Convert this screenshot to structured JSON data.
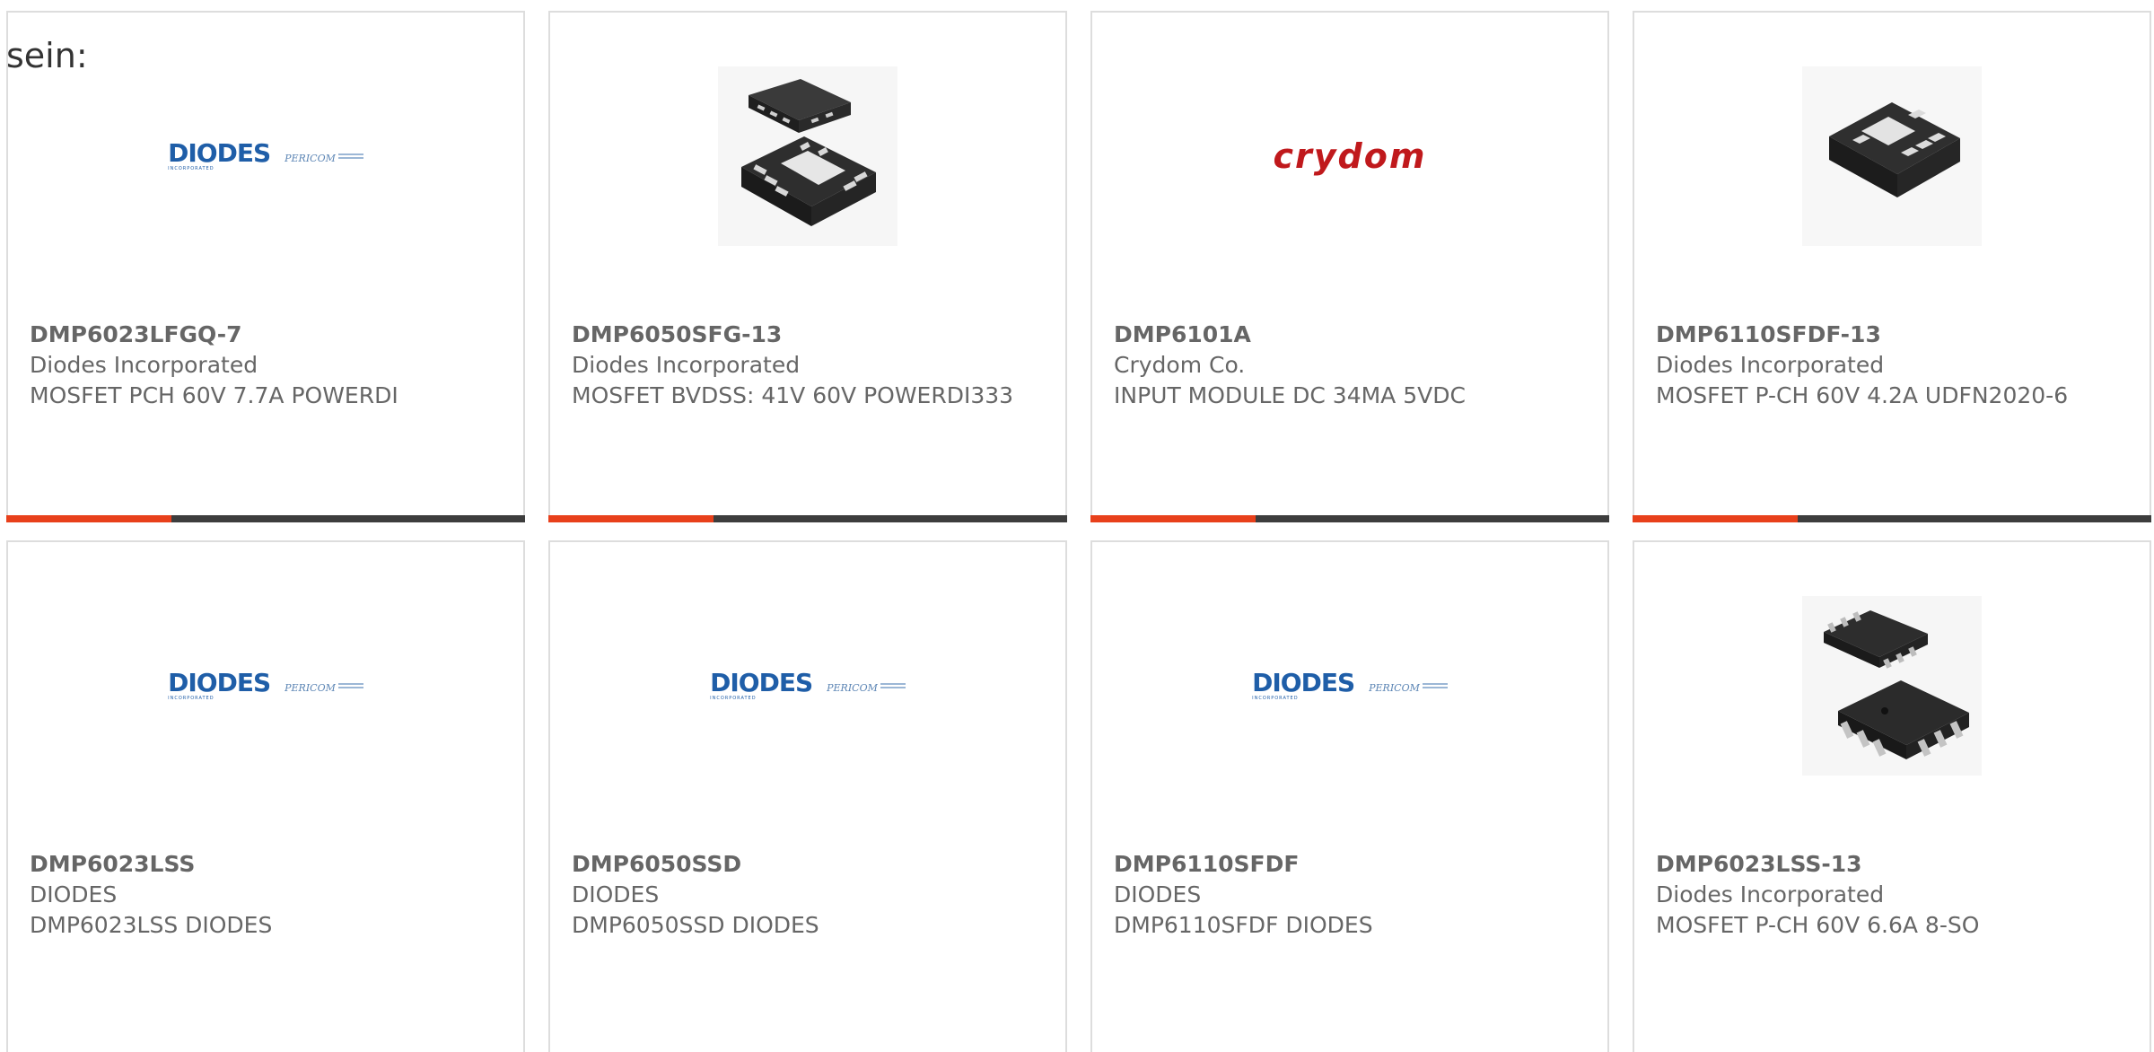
{
  "intro_text": "sein:",
  "colors": {
    "accent_orange": "#e8401b",
    "accent_dark": "#3d3d3d",
    "text": "#666666",
    "diodes_blue": "#1f5ea8",
    "crydom_red": "#c0191c"
  },
  "logos": {
    "diodes": {
      "word": "DIODES",
      "sub": "INCORPORATED",
      "pericom": "PERICOM",
      "pericom_sub": ""
    },
    "crydom": {
      "word": "crydom"
    }
  },
  "products": [
    {
      "part_number": "DMP6023LFGQ-7",
      "manufacturer": "Diodes Incorporated",
      "description": "MOSFET PCH 60V 7.7A POWERDI",
      "image": "diodes-pericom-logo"
    },
    {
      "part_number": "DMP6050SFG-13",
      "manufacturer": "Diodes Incorporated",
      "description": "MOSFET BVDSS: 41V 60V POWERDI333",
      "image": "qfn-chip-photo"
    },
    {
      "part_number": "DMP6101A",
      "manufacturer": "Crydom Co.",
      "description": "INPUT MODULE DC 34MA 5VDC",
      "image": "crydom-logo"
    },
    {
      "part_number": "DMP6110SFDF-13",
      "manufacturer": "Diodes Incorporated",
      "description": "MOSFET P-CH 60V 4.2A UDFN2020-6",
      "image": "udfn-chip-photo"
    },
    {
      "part_number": "DMP6023LSS",
      "manufacturer": "DIODES",
      "description": "DMP6023LSS DIODES",
      "image": "diodes-pericom-logo"
    },
    {
      "part_number": "DMP6050SSD",
      "manufacturer": "DIODES",
      "description": "DMP6050SSD DIODES",
      "image": "diodes-pericom-logo"
    },
    {
      "part_number": "DMP6110SFDF",
      "manufacturer": "DIODES",
      "description": "DMP6110SFDF DIODES",
      "image": "diodes-pericom-logo"
    },
    {
      "part_number": "DMP6023LSS-13",
      "manufacturer": "Diodes Incorporated",
      "description": "MOSFET P-CH 60V 6.6A 8-SO",
      "image": "so8-chip-photo"
    }
  ]
}
